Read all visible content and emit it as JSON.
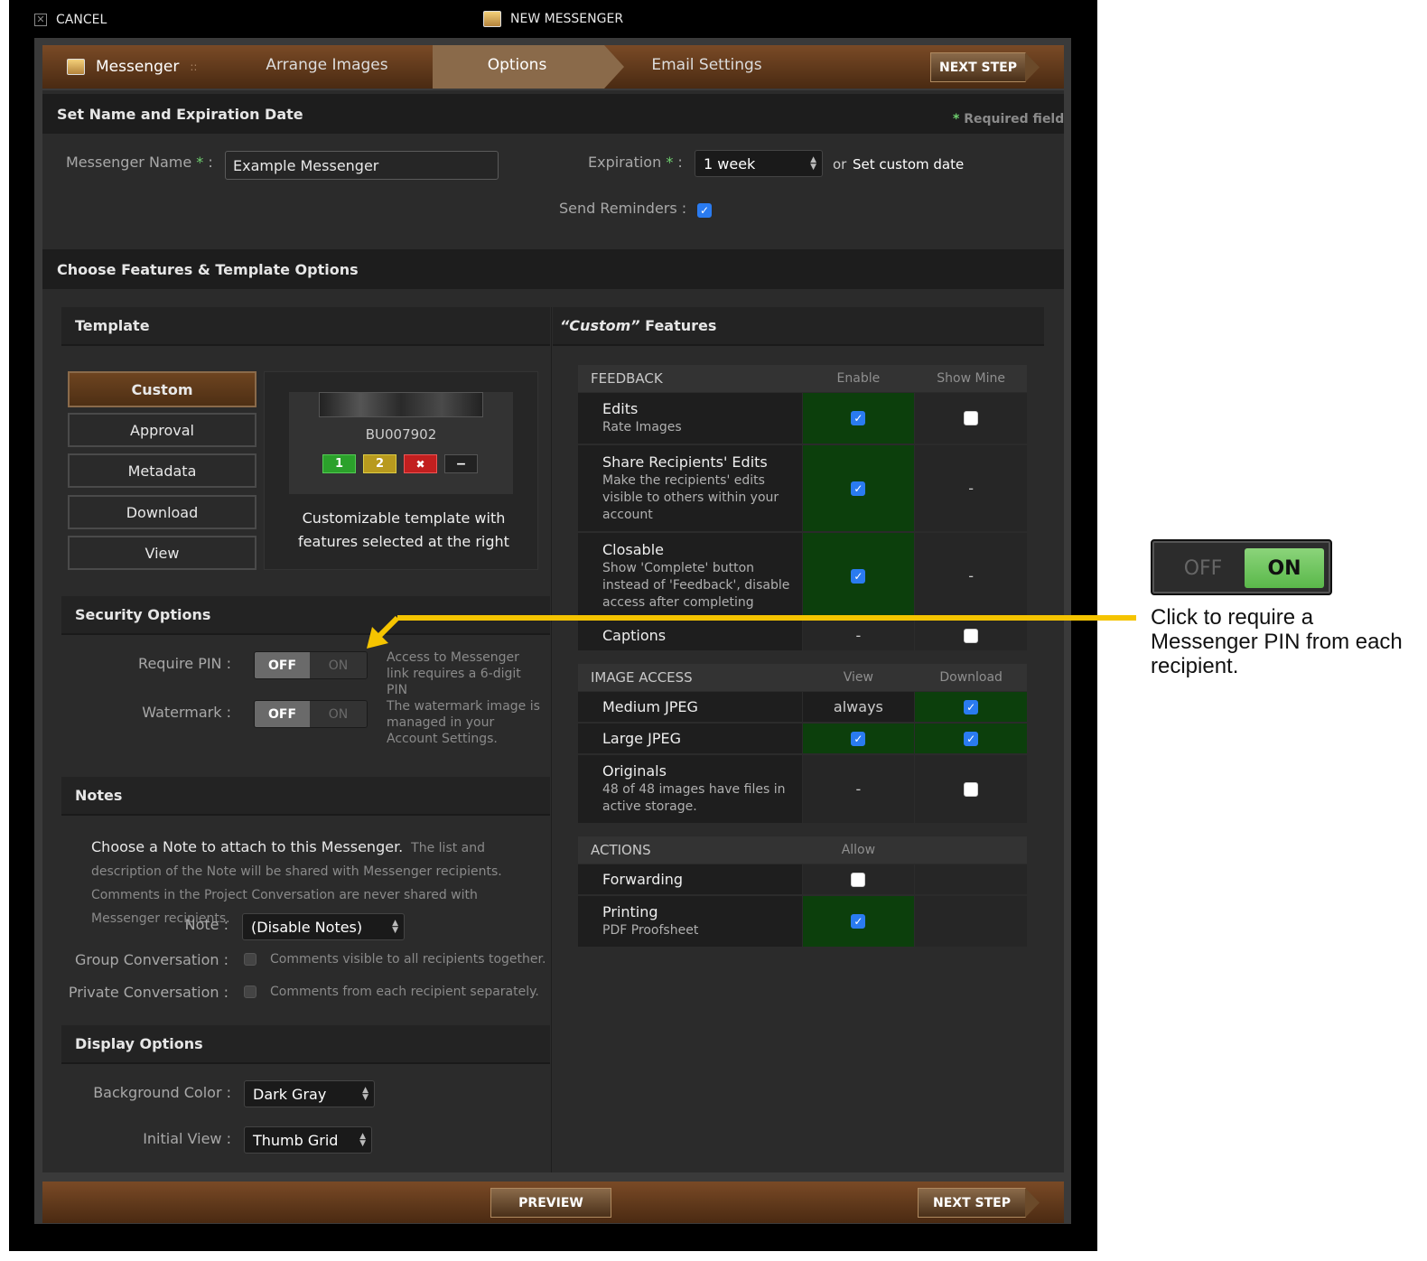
{
  "topbar": {
    "cancel": "CANCEL",
    "title": "NEW MESSENGER"
  },
  "wizard": {
    "brand": "Messenger",
    "sep": "::",
    "steps": [
      "Arrange Images",
      "Options",
      "Email Settings"
    ],
    "active_step": "Options",
    "next": "NEXT STEP"
  },
  "section1": {
    "title": "Set Name and Expiration Date",
    "required_star": "*",
    "required": "Required field",
    "name_label": "Messenger Name",
    "name_value": "Example Messenger",
    "expiration_label": "Expiration",
    "expiration_value": "1 week",
    "or": "or",
    "custom_date": "Set custom date",
    "reminders_label": "Send Reminders :",
    "reminders_checked": true
  },
  "section2": {
    "title": "Choose Features & Template Options"
  },
  "template": {
    "title": "Template",
    "buttons": [
      "Custom",
      "Approval",
      "Metadata",
      "Download",
      "View"
    ],
    "active": "Custom",
    "preview_id": "BU007902",
    "ratings": [
      "1",
      "2",
      "",
      "−"
    ],
    "description": "Customizable template with features selected at the right"
  },
  "security": {
    "title": "Security Options",
    "pin_label": "Require PIN :",
    "pin_off": "OFF",
    "pin_on": "ON",
    "pin_help": "Access to Messenger link requires a 6-digit PIN",
    "wm_label": "Watermark :",
    "wm_off": "OFF",
    "wm_on": "ON",
    "wm_help": "The watermark image is managed in your Account Settings."
  },
  "notes": {
    "title": "Notes",
    "lead": "Choose a Note to attach to this Messenger.",
    "detail": "The list and description of the Note will be shared with Messenger recipients. Comments in the Project Conversation are never shared with Messenger recipients.",
    "note_label": "Note :",
    "note_value": "(Disable Notes)",
    "group_label": "Group Conversation :",
    "group_help": "Comments visible to all recipients together.",
    "private_label": "Private Conversation :",
    "private_help": "Comments from each recipient separately."
  },
  "display": {
    "title": "Display Options",
    "bg_label": "Background Color :",
    "bg_value": "Dark Gray",
    "view_label": "Initial View :",
    "view_value": "Thumb Grid"
  },
  "features": {
    "title_quote": "“Custom”",
    "title_rest": "Features",
    "feedback": {
      "head": "FEEDBACK",
      "col1": "Enable",
      "col2": "Show Mine",
      "rows": [
        {
          "name": "Edits",
          "desc": "Rate Images",
          "c1": "checked",
          "c2": "unchecked"
        },
        {
          "name": "Share Recipients' Edits",
          "desc": "Make the recipients' edits visible to others within your account",
          "c1": "checked",
          "c2": "-"
        },
        {
          "name": "Closable",
          "desc": "Show 'Complete' button instead of 'Feedback', disable access after completing",
          "c1": "checked",
          "c2": "-"
        },
        {
          "name": "Captions",
          "desc": "",
          "c1": "-",
          "c2": "unchecked"
        }
      ]
    },
    "image_access": {
      "head": "IMAGE ACCESS",
      "col1": "View",
      "col2": "Download",
      "rows": [
        {
          "name": "Medium JPEG",
          "desc": "",
          "c1": "always",
          "c2": "checked"
        },
        {
          "name": "Large JPEG",
          "desc": "",
          "c1": "checked",
          "c2": "checked"
        },
        {
          "name": "Originals",
          "desc": "48 of 48 images have files in active storage.",
          "c1": "-",
          "c2": "unchecked"
        }
      ]
    },
    "actions": {
      "head": "ACTIONS",
      "col1": "Allow",
      "rows": [
        {
          "name": "Forwarding",
          "desc": "",
          "c1": "unchecked"
        },
        {
          "name": "Printing",
          "desc": "PDF Proofsheet",
          "c1": "checked"
        }
      ]
    }
  },
  "footer": {
    "preview": "PREVIEW",
    "next": "NEXT STEP"
  },
  "callout": {
    "off": "OFF",
    "on": "ON",
    "text": "Click to require a Messenger PIN from each recipient.",
    "arrow_color": "#f5c400"
  }
}
